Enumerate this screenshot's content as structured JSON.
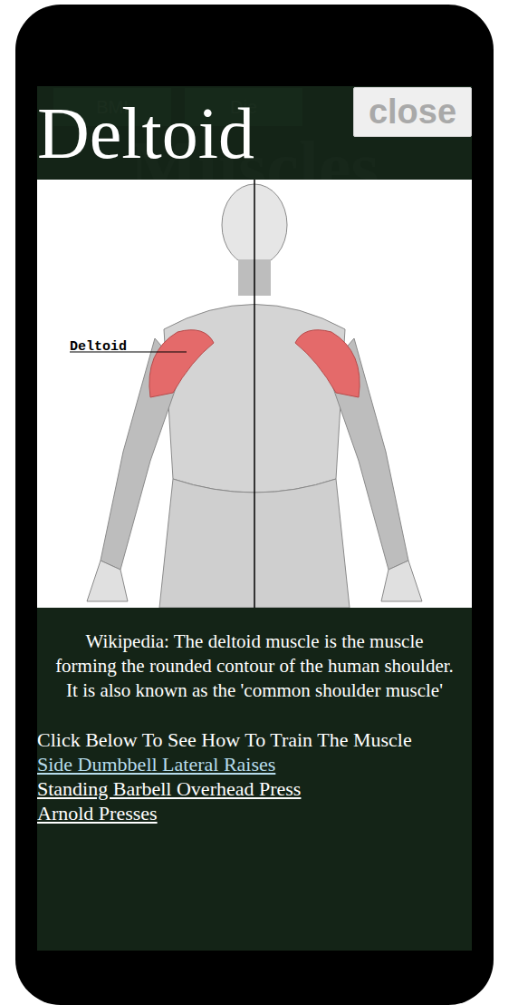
{
  "background": {
    "buttons": [
      "BMI",
      "Die"
    ],
    "title": "Muscles"
  },
  "modal": {
    "title": "Deltoid",
    "close": "close",
    "figure": {
      "label": "Deltoid"
    },
    "description": "Wikipedia: The deltoid muscle is the muscle forming the rounded contour of the human shoulder. It is also known as the 'common shoulder muscle'",
    "prompt": "Click Below To See How To Train The Muscle",
    "exercises": [
      {
        "label": "Side Dumbbell Lateral Raises",
        "visited": true
      },
      {
        "label": "Standing Barbell Overhead Press",
        "visited": false
      },
      {
        "label": "Arnold Presses",
        "visited": false
      }
    ]
  }
}
